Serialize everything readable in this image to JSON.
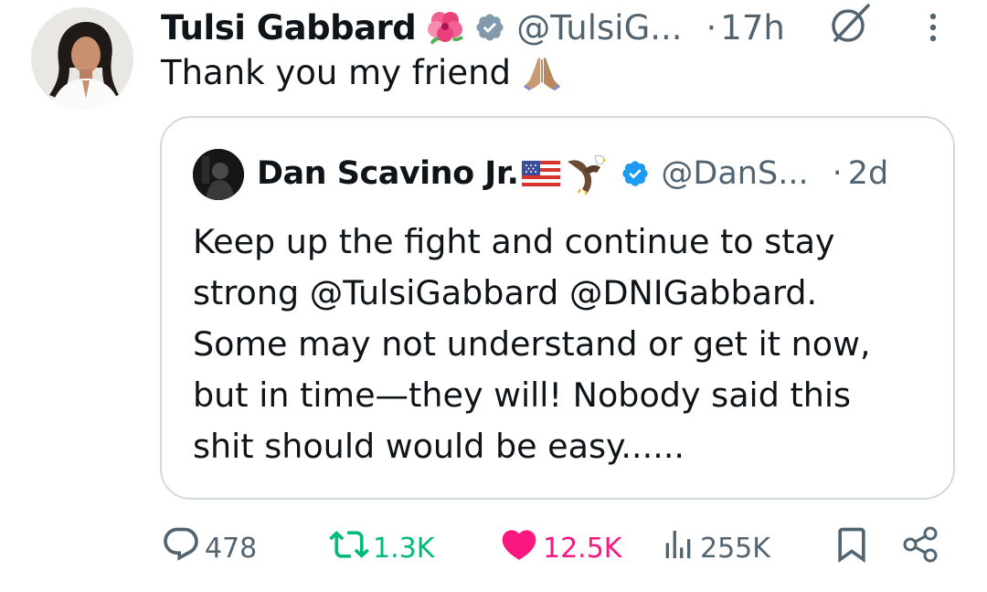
{
  "tweet": {
    "author_name": "Tulsi Gabbard",
    "author_emoji": "hibiscus-emoji",
    "handle": "@TulsiG...",
    "separator": "·",
    "time": "17h",
    "text": "Thank you my friend",
    "text_emoji": "folded-hands-emoji"
  },
  "quote": {
    "author_name": "Dan Scavino Jr.",
    "author_emojis": [
      "us-flag-emoji",
      "eagle-emoji"
    ],
    "handle": "@DanS...",
    "separator": "·",
    "time": "2d",
    "text": "Keep up the fight and continue to stay\nstrong @TulsiGabbard @DNIGabbard.\nSome may not understand or get it now,\nbut in time—they will! Nobody said this\nshit should would be easy......"
  },
  "actions": {
    "replies": "478",
    "retweets": "1.3K",
    "likes": "12.5K",
    "views": "255K"
  },
  "colors": {
    "verified_badge": "#1d9bf0",
    "muted_text": "#536471",
    "retweet_active": "#00ba7c",
    "like_active": "#f91880",
    "border": "#cfd9de"
  },
  "icons": [
    "grok-icon",
    "more-icon",
    "verified-badge-icon",
    "reply-icon",
    "retweet-icon",
    "like-icon",
    "views-icon",
    "bookmark-icon",
    "share-icon"
  ]
}
